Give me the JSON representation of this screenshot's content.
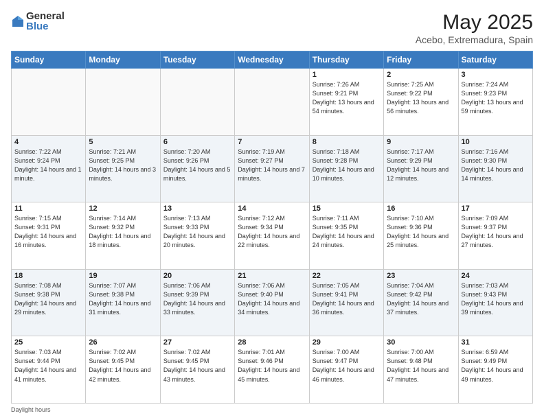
{
  "header": {
    "logo_general": "General",
    "logo_blue": "Blue",
    "title": "May 2025",
    "subtitle": "Acebo, Extremadura, Spain"
  },
  "weekdays": [
    "Sunday",
    "Monday",
    "Tuesday",
    "Wednesday",
    "Thursday",
    "Friday",
    "Saturday"
  ],
  "footer": "Daylight hours",
  "weeks": [
    [
      {
        "day": "",
        "sunrise": "",
        "sunset": "",
        "daylight": ""
      },
      {
        "day": "",
        "sunrise": "",
        "sunset": "",
        "daylight": ""
      },
      {
        "day": "",
        "sunrise": "",
        "sunset": "",
        "daylight": ""
      },
      {
        "day": "",
        "sunrise": "",
        "sunset": "",
        "daylight": ""
      },
      {
        "day": "1",
        "sunrise": "Sunrise: 7:26 AM",
        "sunset": "Sunset: 9:21 PM",
        "daylight": "Daylight: 13 hours and 54 minutes."
      },
      {
        "day": "2",
        "sunrise": "Sunrise: 7:25 AM",
        "sunset": "Sunset: 9:22 PM",
        "daylight": "Daylight: 13 hours and 56 minutes."
      },
      {
        "day": "3",
        "sunrise": "Sunrise: 7:24 AM",
        "sunset": "Sunset: 9:23 PM",
        "daylight": "Daylight: 13 hours and 59 minutes."
      }
    ],
    [
      {
        "day": "4",
        "sunrise": "Sunrise: 7:22 AM",
        "sunset": "Sunset: 9:24 PM",
        "daylight": "Daylight: 14 hours and 1 minute."
      },
      {
        "day": "5",
        "sunrise": "Sunrise: 7:21 AM",
        "sunset": "Sunset: 9:25 PM",
        "daylight": "Daylight: 14 hours and 3 minutes."
      },
      {
        "day": "6",
        "sunrise": "Sunrise: 7:20 AM",
        "sunset": "Sunset: 9:26 PM",
        "daylight": "Daylight: 14 hours and 5 minutes."
      },
      {
        "day": "7",
        "sunrise": "Sunrise: 7:19 AM",
        "sunset": "Sunset: 9:27 PM",
        "daylight": "Daylight: 14 hours and 7 minutes."
      },
      {
        "day": "8",
        "sunrise": "Sunrise: 7:18 AM",
        "sunset": "Sunset: 9:28 PM",
        "daylight": "Daylight: 14 hours and 10 minutes."
      },
      {
        "day": "9",
        "sunrise": "Sunrise: 7:17 AM",
        "sunset": "Sunset: 9:29 PM",
        "daylight": "Daylight: 14 hours and 12 minutes."
      },
      {
        "day": "10",
        "sunrise": "Sunrise: 7:16 AM",
        "sunset": "Sunset: 9:30 PM",
        "daylight": "Daylight: 14 hours and 14 minutes."
      }
    ],
    [
      {
        "day": "11",
        "sunrise": "Sunrise: 7:15 AM",
        "sunset": "Sunset: 9:31 PM",
        "daylight": "Daylight: 14 hours and 16 minutes."
      },
      {
        "day": "12",
        "sunrise": "Sunrise: 7:14 AM",
        "sunset": "Sunset: 9:32 PM",
        "daylight": "Daylight: 14 hours and 18 minutes."
      },
      {
        "day": "13",
        "sunrise": "Sunrise: 7:13 AM",
        "sunset": "Sunset: 9:33 PM",
        "daylight": "Daylight: 14 hours and 20 minutes."
      },
      {
        "day": "14",
        "sunrise": "Sunrise: 7:12 AM",
        "sunset": "Sunset: 9:34 PM",
        "daylight": "Daylight: 14 hours and 22 minutes."
      },
      {
        "day": "15",
        "sunrise": "Sunrise: 7:11 AM",
        "sunset": "Sunset: 9:35 PM",
        "daylight": "Daylight: 14 hours and 24 minutes."
      },
      {
        "day": "16",
        "sunrise": "Sunrise: 7:10 AM",
        "sunset": "Sunset: 9:36 PM",
        "daylight": "Daylight: 14 hours and 25 minutes."
      },
      {
        "day": "17",
        "sunrise": "Sunrise: 7:09 AM",
        "sunset": "Sunset: 9:37 PM",
        "daylight": "Daylight: 14 hours and 27 minutes."
      }
    ],
    [
      {
        "day": "18",
        "sunrise": "Sunrise: 7:08 AM",
        "sunset": "Sunset: 9:38 PM",
        "daylight": "Daylight: 14 hours and 29 minutes."
      },
      {
        "day": "19",
        "sunrise": "Sunrise: 7:07 AM",
        "sunset": "Sunset: 9:38 PM",
        "daylight": "Daylight: 14 hours and 31 minutes."
      },
      {
        "day": "20",
        "sunrise": "Sunrise: 7:06 AM",
        "sunset": "Sunset: 9:39 PM",
        "daylight": "Daylight: 14 hours and 33 minutes."
      },
      {
        "day": "21",
        "sunrise": "Sunrise: 7:06 AM",
        "sunset": "Sunset: 9:40 PM",
        "daylight": "Daylight: 14 hours and 34 minutes."
      },
      {
        "day": "22",
        "sunrise": "Sunrise: 7:05 AM",
        "sunset": "Sunset: 9:41 PM",
        "daylight": "Daylight: 14 hours and 36 minutes."
      },
      {
        "day": "23",
        "sunrise": "Sunrise: 7:04 AM",
        "sunset": "Sunset: 9:42 PM",
        "daylight": "Daylight: 14 hours and 37 minutes."
      },
      {
        "day": "24",
        "sunrise": "Sunrise: 7:03 AM",
        "sunset": "Sunset: 9:43 PM",
        "daylight": "Daylight: 14 hours and 39 minutes."
      }
    ],
    [
      {
        "day": "25",
        "sunrise": "Sunrise: 7:03 AM",
        "sunset": "Sunset: 9:44 PM",
        "daylight": "Daylight: 14 hours and 41 minutes."
      },
      {
        "day": "26",
        "sunrise": "Sunrise: 7:02 AM",
        "sunset": "Sunset: 9:45 PM",
        "daylight": "Daylight: 14 hours and 42 minutes."
      },
      {
        "day": "27",
        "sunrise": "Sunrise: 7:02 AM",
        "sunset": "Sunset: 9:45 PM",
        "daylight": "Daylight: 14 hours and 43 minutes."
      },
      {
        "day": "28",
        "sunrise": "Sunrise: 7:01 AM",
        "sunset": "Sunset: 9:46 PM",
        "daylight": "Daylight: 14 hours and 45 minutes."
      },
      {
        "day": "29",
        "sunrise": "Sunrise: 7:00 AM",
        "sunset": "Sunset: 9:47 PM",
        "daylight": "Daylight: 14 hours and 46 minutes."
      },
      {
        "day": "30",
        "sunrise": "Sunrise: 7:00 AM",
        "sunset": "Sunset: 9:48 PM",
        "daylight": "Daylight: 14 hours and 47 minutes."
      },
      {
        "day": "31",
        "sunrise": "Sunrise: 6:59 AM",
        "sunset": "Sunset: 9:49 PM",
        "daylight": "Daylight: 14 hours and 49 minutes."
      }
    ]
  ]
}
